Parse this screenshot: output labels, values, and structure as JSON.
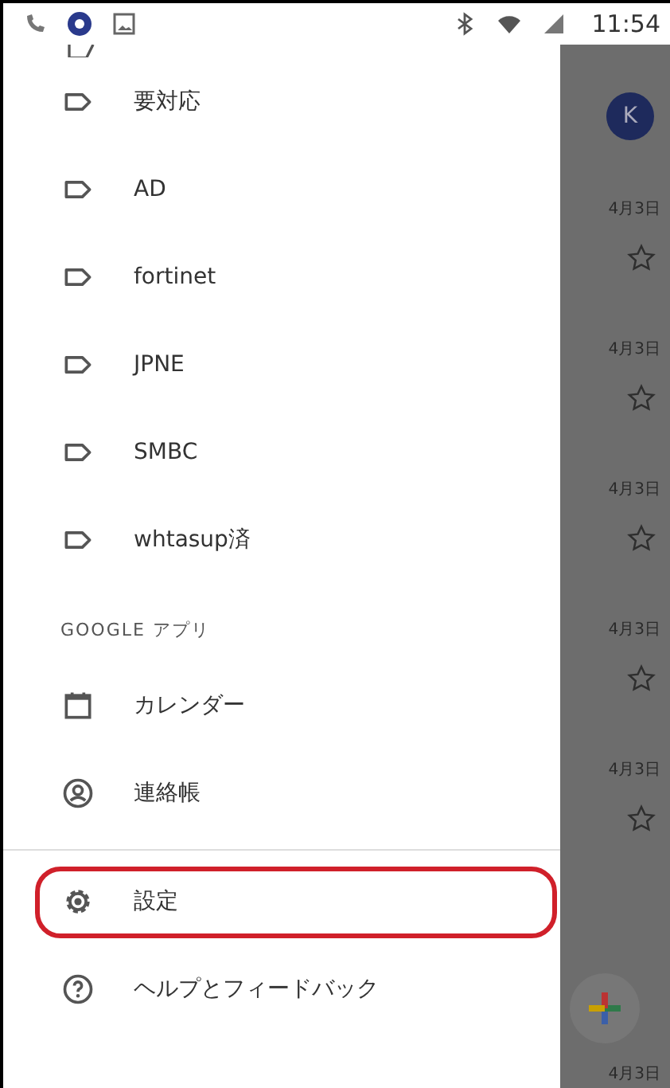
{
  "status_bar": {
    "time": "11:54"
  },
  "drawer": {
    "labels": [
      {
        "label": "要対応"
      },
      {
        "label": "AD"
      },
      {
        "label": "fortinet"
      },
      {
        "label": "JPNE"
      },
      {
        "label": "SMBC"
      },
      {
        "label": "whtasup済"
      }
    ],
    "section_header": "GOOGLE アプリ",
    "apps": [
      {
        "kind": "calendar",
        "label": "カレンダー"
      },
      {
        "kind": "contacts",
        "label": "連絡帳"
      }
    ],
    "footer": [
      {
        "kind": "settings",
        "label": "設定",
        "highlighted": true
      },
      {
        "kind": "help",
        "label": "ヘルプとフィードバック",
        "highlighted": false
      }
    ]
  },
  "background": {
    "avatar": "K",
    "rows": [
      {
        "date": "4月3日",
        "starred": false
      },
      {
        "date": "4月3日",
        "starred": false
      },
      {
        "date": "4月3日",
        "starred": false
      },
      {
        "date": "4月3日",
        "starred": false
      },
      {
        "date": "4月3日",
        "starred": false
      }
    ],
    "last_date": "4月3日"
  }
}
